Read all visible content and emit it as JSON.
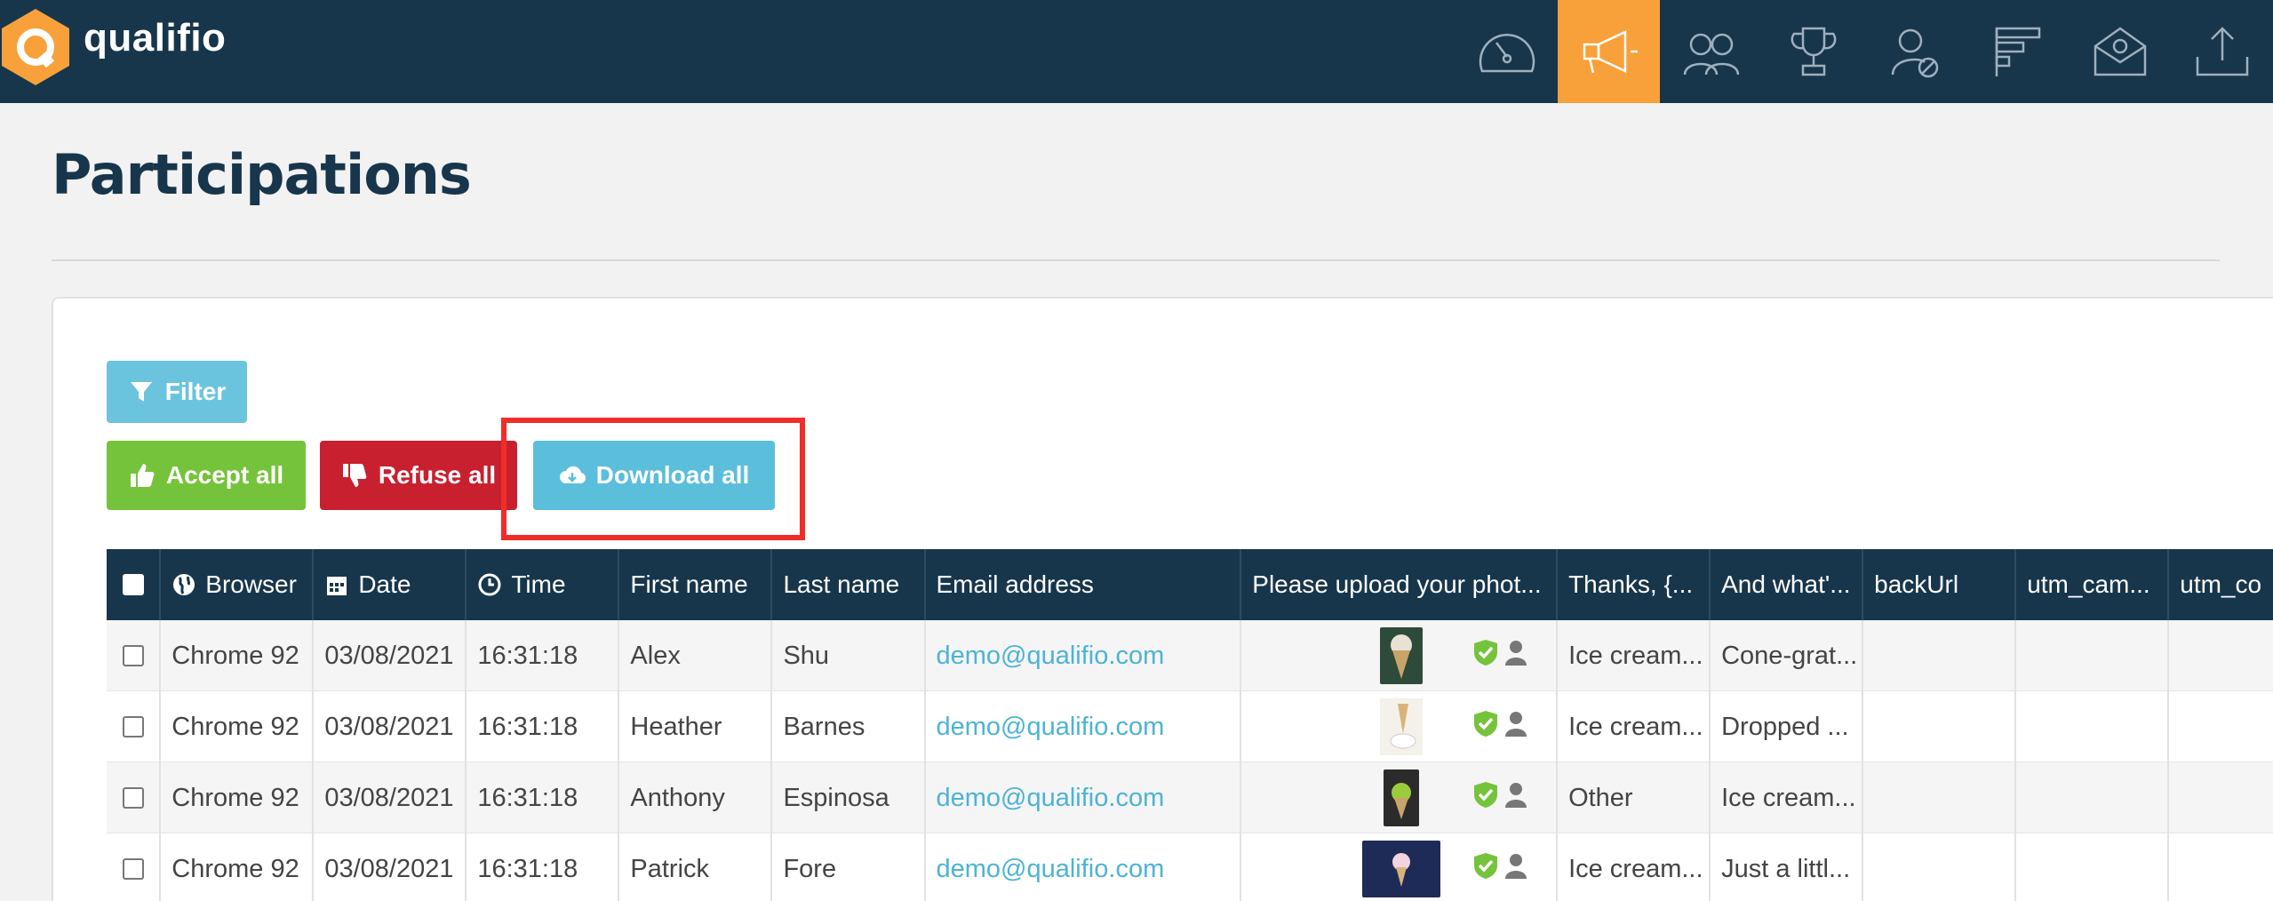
{
  "app": {
    "brand": "qualifio"
  },
  "nav": {
    "icons": [
      {
        "name": "dashboard-gauge-icon",
        "active": false
      },
      {
        "name": "megaphone-icon",
        "active": true
      },
      {
        "name": "participants-icon",
        "active": false
      },
      {
        "name": "trophy-icon",
        "active": false
      },
      {
        "name": "user-blocked-icon",
        "active": false
      },
      {
        "name": "stacked-bars-icon",
        "active": false
      },
      {
        "name": "email-icon",
        "active": false
      },
      {
        "name": "export-upload-icon",
        "active": false
      }
    ],
    "accent": "#f8a13a",
    "background": "#17364c"
  },
  "page": {
    "title": "Participations"
  },
  "toolbar": {
    "filter_label": "Filter",
    "accept_label": "Accept all",
    "refuse_label": "Refuse all",
    "download_label": "Download all"
  },
  "table": {
    "headers": [
      "Browser",
      "Date",
      "Time",
      "First name",
      "Last name",
      "Email address",
      "Please upload your phot...",
      "Thanks, {...",
      "And what'...",
      "backUrl",
      "utm_cam...",
      "utm_co"
    ],
    "rows": [
      {
        "browser": "Chrome 92",
        "date": "03/08/2021",
        "time": "16:31:18",
        "first": "Alex",
        "last": "Shu",
        "email": "demo@qualifio.com",
        "thanks": "Ice cream...",
        "andwhat": "Cone-grat..."
      },
      {
        "browser": "Chrome 92",
        "date": "03/08/2021",
        "time": "16:31:18",
        "first": "Heather",
        "last": "Barnes",
        "email": "demo@qualifio.com",
        "thanks": "Ice cream...",
        "andwhat": "Dropped ..."
      },
      {
        "browser": "Chrome 92",
        "date": "03/08/2021",
        "time": "16:31:18",
        "first": "Anthony",
        "last": "Espinosa",
        "email": "demo@qualifio.com",
        "thanks": "Other",
        "andwhat": "Ice cream..."
      },
      {
        "browser": "Chrome 92",
        "date": "03/08/2021",
        "time": "16:31:18",
        "first": "Patrick",
        "last": "Fore",
        "email": "demo@qualifio.com",
        "thanks": "Ice cream...",
        "andwhat": "Just a littl..."
      }
    ]
  },
  "colors": {
    "accept": "#75c33a",
    "refuse": "#c8202f",
    "download": "#5bbedb",
    "highlight": "#f12d28",
    "email_link": "#4db3d4"
  }
}
